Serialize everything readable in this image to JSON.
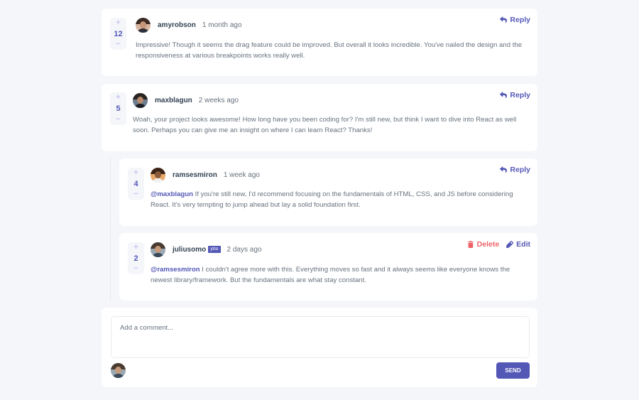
{
  "comments": [
    {
      "username": "amyrobson",
      "time": "1 month ago",
      "score": "12",
      "text": "Impressive! Though it seems the drag feature could be improved. But overall it looks incredible. You've nailed the design and the responsiveness at various breakpoints works really well.",
      "reply_label": "Reply"
    },
    {
      "username": "maxblagun",
      "time": "2 weeks ago",
      "score": "5",
      "text": "Woah, your project looks awesome! How long have you been coding for? I'm still new, but think I want to dive into React as well soon. Perhaps you can give me an insight on where I can learn React? Thanks!",
      "reply_label": "Reply"
    }
  ],
  "replies": [
    {
      "username": "ramsesmiron",
      "time": "1 week ago",
      "score": "4",
      "mention": "@maxblagun",
      "text": " If you're still new, I'd recommend focusing on the fundamentals of HTML, CSS, and JS before considering React. It's very tempting to jump ahead but lay a solid foundation first.",
      "reply_label": "Reply"
    },
    {
      "username": "juliusomo",
      "you_label": "you",
      "time": "2 days ago",
      "score": "2",
      "mention": "@ramsesmiron",
      "text": " I couldn't agree more with this. Everything moves so fast and it always seems like everyone knows the newest library/framework. But the fundamentals are what stay constant.",
      "delete_label": "Delete",
      "edit_label": "Edit"
    }
  ],
  "vote": {
    "plus": "+",
    "minus": "−"
  },
  "add_comment": {
    "placeholder": "Add a comment...",
    "send_label": "SEND"
  },
  "colors": {
    "primary": "#5357b6",
    "danger": "#ed6368",
    "background": "#f5f6fa",
    "text": "#67727e",
    "username": "#334253"
  }
}
